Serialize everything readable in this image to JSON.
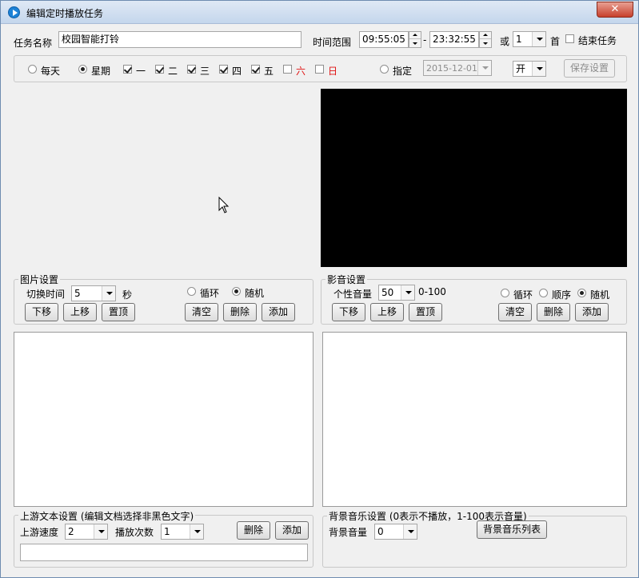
{
  "window": {
    "title": "编辑定时播放任务",
    "close_label": "✕"
  },
  "task": {
    "name_label": "任务名称",
    "name_value": "校园智能打铃",
    "time_range_label": "时间范围",
    "start_time": "09:55:05",
    "separator": "-",
    "end_time": "23:32:55",
    "or_label": "或",
    "count_value": "1",
    "count_unit": "首",
    "end_task_label": "结束任务"
  },
  "schedule": {
    "daily_label": "每天",
    "week_label": "星期",
    "days": [
      "一",
      "二",
      "三",
      "四",
      "五",
      "六",
      "日"
    ],
    "specify_label": "指定",
    "date_value": "2015-12-01",
    "state_value": "开",
    "save_label": "保存设置"
  },
  "image_settings": {
    "legend": "图片设置",
    "switch_time_label": "切换时间",
    "switch_time_value": "5",
    "seconds_label": "秒",
    "loop_label": "循环",
    "random_label": "随机",
    "down_label": "下移",
    "up_label": "上移",
    "top_label": "置顶",
    "clear_label": "清空",
    "delete_label": "删除",
    "add_label": "添加"
  },
  "media_settings": {
    "legend": "影音设置",
    "volume_label": "个性音量",
    "volume_value": "50",
    "range_label": "0-100",
    "loop_label": "循环",
    "order_label": "顺序",
    "random_label": "随机",
    "down_label": "下移",
    "up_label": "上移",
    "top_label": "置顶",
    "clear_label": "清空",
    "delete_label": "删除",
    "add_label": "添加"
  },
  "scroll_text": {
    "legend": "上游文本设置 (编辑文档选择非黑色文字)",
    "speed_label": "上游速度",
    "speed_value": "2",
    "times_label": "播放次数",
    "times_value": "1",
    "delete_label": "删除",
    "add_label": "添加"
  },
  "bg_music": {
    "legend": "背景音乐设置 (0表示不播放，1-100表示音量)",
    "volume_label": "背景音量",
    "volume_value": "0",
    "list_label": "背景音乐列表"
  },
  "colors": {
    "accent": "#1d82d6",
    "weekend": "#e01010",
    "video_bg": "#000000"
  }
}
